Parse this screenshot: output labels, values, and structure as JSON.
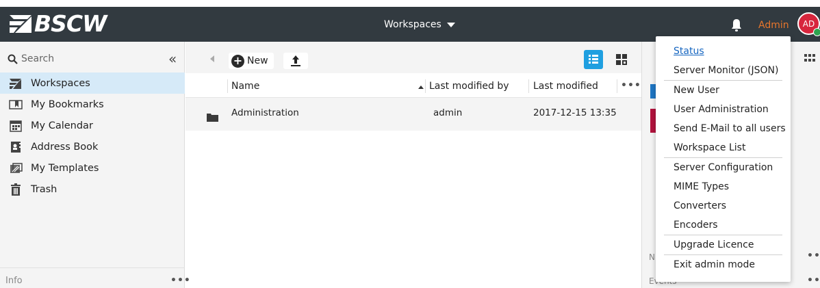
{
  "app": {
    "logo_text": "BSCW"
  },
  "header": {
    "workspaces_menu_label": "Workspaces",
    "admin_label": "Admin",
    "avatar_initials": "AD",
    "colors": {
      "bar": "#323a40",
      "admin_accent": "#e8762c",
      "avatar_bg": "#d7263d"
    }
  },
  "sidebar": {
    "search_label": "Search",
    "collapse_label": "«",
    "items": [
      {
        "label": "Workspaces",
        "icon": "workspaces-icon",
        "active": true
      },
      {
        "label": "My Bookmarks",
        "icon": "bookmarks-icon"
      },
      {
        "label": "My Calendar",
        "icon": "calendar-icon"
      },
      {
        "label": "Address Book",
        "icon": "address-book-icon"
      },
      {
        "label": "My Templates",
        "icon": "templates-icon"
      },
      {
        "label": "Trash",
        "icon": "trash-icon"
      }
    ],
    "info_label": "Info",
    "info_more": "•••"
  },
  "toolbar": {
    "new_label": "New",
    "new_plus": "+"
  },
  "table": {
    "columns": {
      "name": "Name",
      "last_modified_by": "Last modified by",
      "last_modified": "Last modified",
      "more": "•••"
    },
    "rows": [
      {
        "name": "Administration",
        "last_modified_by": "admin",
        "last_modified": "2017-12-15 13:35"
      }
    ]
  },
  "right_panel": {
    "section_n": "N",
    "section_events": "Events",
    "more": "•••"
  },
  "admin_menu": {
    "items": [
      "Status",
      "Server Monitor (JSON)",
      "New User",
      "User Administration",
      "Send E-Mail to all users",
      "Workspace List",
      "Server Configuration",
      "MIME Types",
      "Converters",
      "Encoders",
      "Upgrade Licence",
      "Exit admin mode"
    ]
  }
}
